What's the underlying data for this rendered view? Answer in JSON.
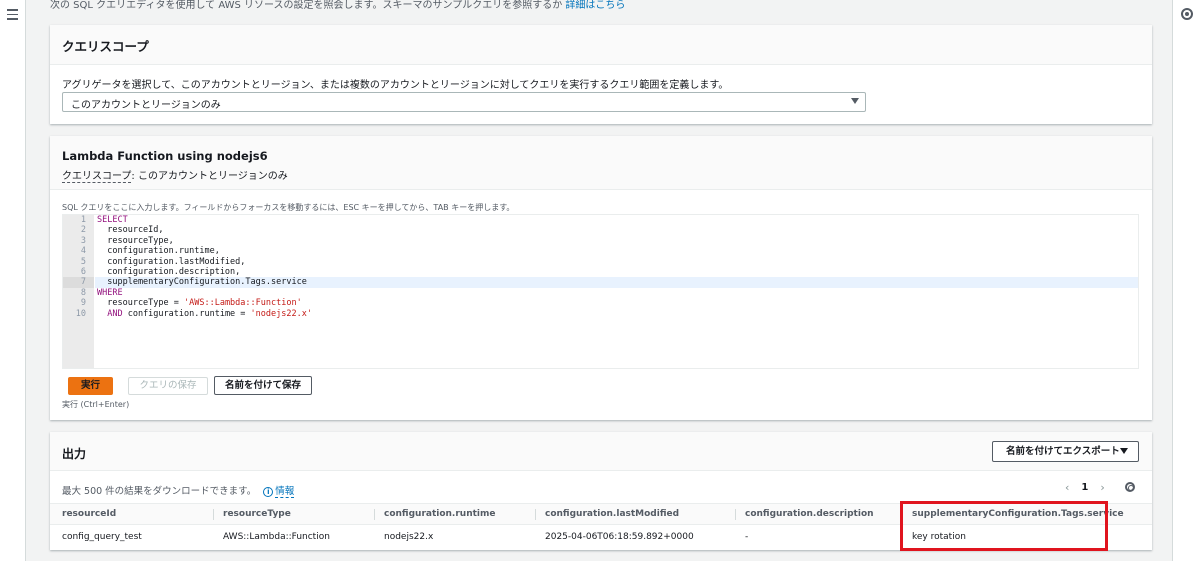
{
  "top_note": {
    "text": "次の SQL クエリエディタを使用して AWS リソースの設定を照会します。スキーマのサンプルクエリを参照するか",
    "link": "詳細はこちら"
  },
  "scope_panel": {
    "title": "クエリスコープ",
    "description": "アグリゲータを選択して、このアカウントとリージョン、または複数のアカウントとリージョンに対してクエリを実行するクエリ範囲を定義します。",
    "select_value": "このアカウントとリージョンのみ"
  },
  "query_panel": {
    "title": "Lambda Function using nodejs6",
    "scope_label": "クエリスコープ",
    "scope_value": ": このアカウントとリージョンのみ",
    "editor_hint": "SQL クエリをここに入力します。フィールドからフォーカスを移動するには、ESC キーを押してから、TAB キーを押します。",
    "line_numbers": [
      "1",
      "2",
      "3",
      "4",
      "5",
      "6",
      "7",
      "8",
      "9",
      "10"
    ],
    "code": {
      "l1_kw": "SELECT",
      "l2": "  resourceId,",
      "l3": "  resourceType,",
      "l4": "  configuration.runtime,",
      "l5": "  configuration.lastModified,",
      "l6": "  configuration.description,",
      "l7": "  supplementaryConfiguration.Tags.service",
      "l8_kw": "WHERE",
      "l9_a": "  resourceType = ",
      "l9_str": "'AWS::Lambda::Function'",
      "l10_kw": "  AND",
      "l10_a": " configuration.runtime = ",
      "l10_str": "'nodejs22.x'"
    },
    "run_label": "実行",
    "save_label": "クエリの保存",
    "save_as_label": "名前を付けて保存",
    "run_hint": "実行 (Ctrl+Enter)"
  },
  "output_panel": {
    "title": "出力",
    "export_label": "名前を付けてエクスポート",
    "download_note": "最大 500 件の結果をダウンロードできます。",
    "info_icon": "i",
    "info_link": "情報",
    "page_prev": "‹",
    "page_current": "1",
    "page_next": "›",
    "columns": [
      "resourceId",
      "resourceType",
      "configuration.runtime",
      "configuration.lastModified",
      "configuration.description",
      "supplementaryConfiguration.Tags.service"
    ],
    "rows": [
      [
        "config_query_test",
        "AWS::Lambda::Function",
        "nodejs22.x",
        "2025-04-06T06:18:59.892+0000",
        "-",
        "key rotation"
      ]
    ]
  },
  "colors": {
    "accent": "#ec7211",
    "link": "#0073bb",
    "highlight": "#e0141e"
  }
}
